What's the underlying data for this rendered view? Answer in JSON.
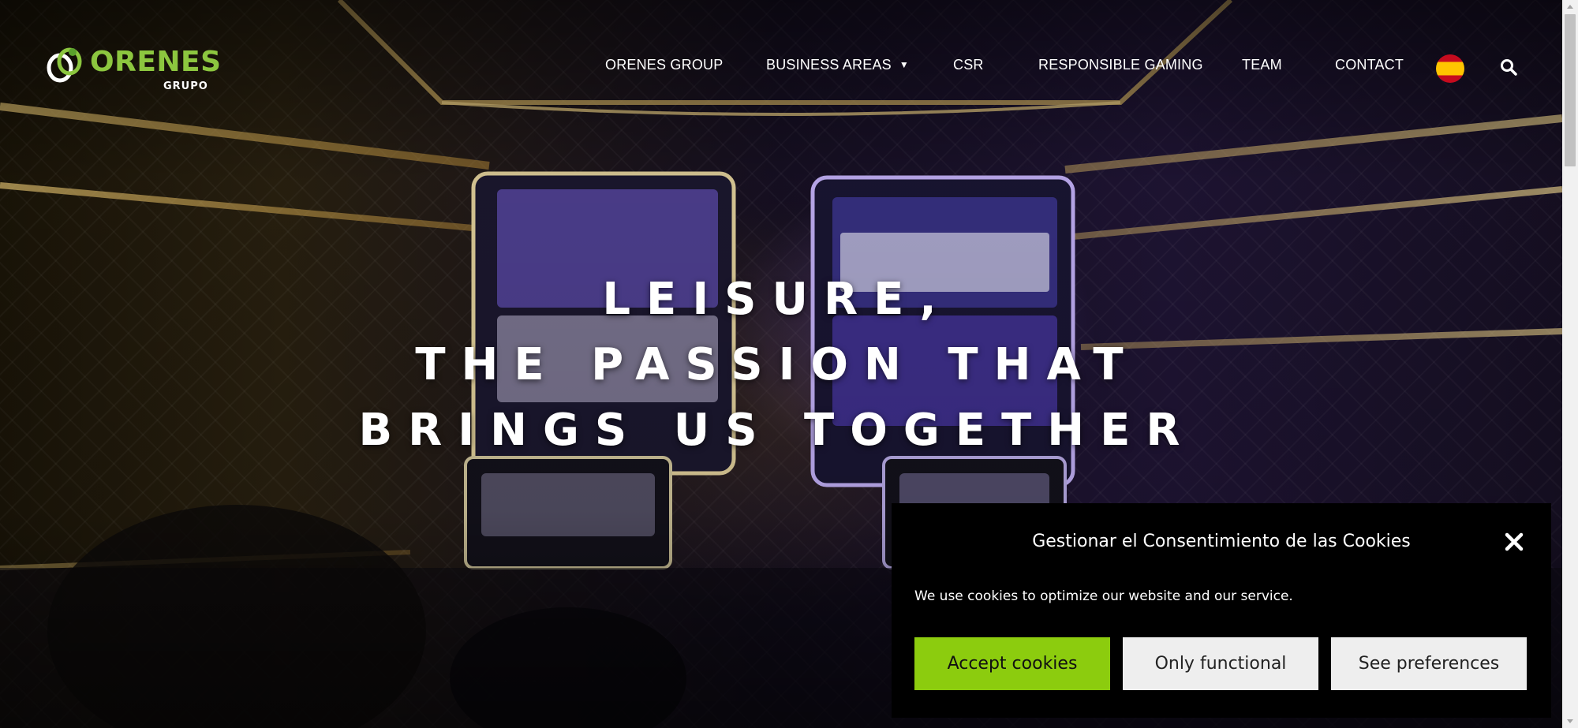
{
  "brand": {
    "name": "ORENES",
    "sub": "GRUPO",
    "color": "#8cc63f"
  },
  "nav": {
    "items": [
      {
        "label": "ORENES GROUP"
      },
      {
        "label": "BUSINESS AREAS",
        "has_dropdown": true
      },
      {
        "label": "CSR"
      },
      {
        "label": "RESPONSIBLE GAMING"
      },
      {
        "label": "TEAM"
      },
      {
        "label": "CONTACT"
      }
    ],
    "dropdown_icon": "chevron-down-icon",
    "language_icon": "spain-flag-icon",
    "search_icon": "search-icon"
  },
  "hero": {
    "lines": [
      "LEISURE,",
      "THE PASSION THAT",
      "BRINGS US TOGETHER"
    ]
  },
  "cookie": {
    "title": "Gestionar el Consentimiento de las Cookies",
    "message": "We use cookies to optimize our website and our service.",
    "accept_label": "Accept cookies",
    "functional_label": "Only functional",
    "preferences_label": "See preferences",
    "close_icon": "close-icon",
    "accent": "#8ccc0e"
  }
}
